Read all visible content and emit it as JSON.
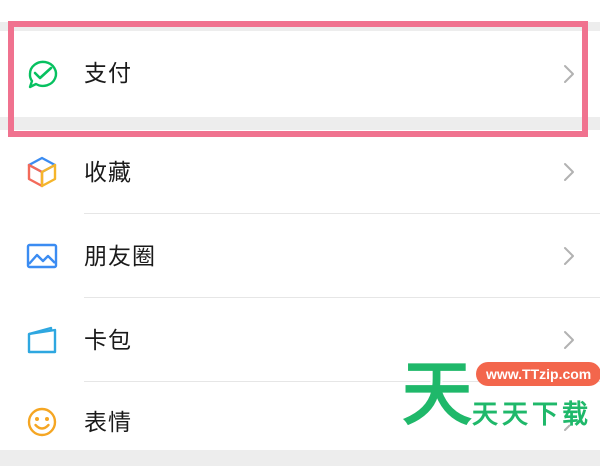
{
  "menu": {
    "pay": {
      "label": "支付",
      "icon": "wallet-check-icon"
    },
    "items": [
      {
        "label": "收藏",
        "icon": "cube-icon"
      },
      {
        "label": "朋友圈",
        "icon": "picture-icon"
      },
      {
        "label": "卡包",
        "icon": "card-icon"
      },
      {
        "label": "表情",
        "icon": "smile-icon"
      }
    ]
  },
  "watermark": {
    "big_char": "天",
    "url": "www.TTzip.com",
    "brand": "天天下载"
  },
  "colors": {
    "highlight": "#f0728f",
    "pay_green": "#07c160",
    "watermark_green": "#1fb86a",
    "watermark_orange": "#f3664c"
  }
}
